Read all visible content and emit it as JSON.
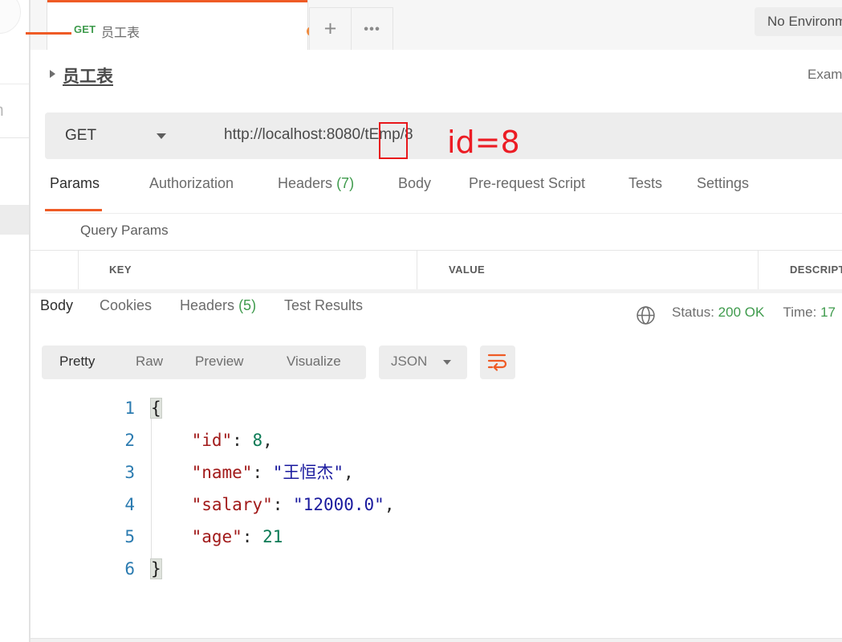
{
  "left_rail": {
    "glyph_fragment": "n"
  },
  "tabbar": {
    "request_tab": {
      "method": "GET",
      "title": "员工表",
      "unsaved": true
    },
    "new_tab_icon": "plus-icon",
    "more_icon": "ellipsis-icon",
    "environment": "No Environment"
  },
  "breadcrumb": {
    "name": "员工表",
    "examples_label": "Examples"
  },
  "url_bar": {
    "method": "GET",
    "url": "http://localhost:8080/tEmp/8"
  },
  "annotation": {
    "label": "id=8",
    "color": "#ec1c24"
  },
  "request_tabs": [
    {
      "label": "Params",
      "count": null,
      "active": true
    },
    {
      "label": "Authorization",
      "count": null,
      "active": false
    },
    {
      "label": "Headers",
      "count": "(7)",
      "active": false
    },
    {
      "label": "Body",
      "count": null,
      "active": false
    },
    {
      "label": "Pre-request Script",
      "count": null,
      "active": false
    },
    {
      "label": "Tests",
      "count": null,
      "active": false
    },
    {
      "label": "Settings",
      "count": null,
      "active": false
    }
  ],
  "query_params": {
    "section_label": "Query Params",
    "columns": [
      "KEY",
      "VALUE",
      "DESCRIPTION"
    ]
  },
  "response_tabs": [
    {
      "label": "Body",
      "count": null,
      "active": true
    },
    {
      "label": "Cookies",
      "count": null,
      "active": false
    },
    {
      "label": "Headers",
      "count": "(5)",
      "active": false
    },
    {
      "label": "Test Results",
      "count": null,
      "active": false
    }
  ],
  "response_meta": {
    "status_label": "Status:",
    "status_value": "200 OK",
    "time_label": "Time:",
    "time_value": "17",
    "globe_icon": "globe-icon"
  },
  "format_toolbar": {
    "buttons": [
      {
        "label": "Pretty",
        "active": true
      },
      {
        "label": "Raw",
        "active": false
      },
      {
        "label": "Preview",
        "active": false
      },
      {
        "label": "Visualize",
        "active": false
      }
    ],
    "language": "JSON",
    "wrap_icon": "word-wrap-icon"
  },
  "response_body": {
    "language": "json",
    "lines": [
      {
        "n": "1",
        "tokens": [
          {
            "t": "{",
            "c": "tok-brace"
          }
        ]
      },
      {
        "n": "2",
        "tokens": [
          {
            "t": "    ",
            "c": "tok-punct"
          },
          {
            "t": "\"id\"",
            "c": "tok-key"
          },
          {
            "t": ": ",
            "c": "tok-punct"
          },
          {
            "t": "8",
            "c": "tok-num"
          },
          {
            "t": ",",
            "c": "tok-punct"
          }
        ]
      },
      {
        "n": "3",
        "tokens": [
          {
            "t": "    ",
            "c": "tok-punct"
          },
          {
            "t": "\"name\"",
            "c": "tok-key"
          },
          {
            "t": ": ",
            "c": "tok-punct"
          },
          {
            "t": "\"王恒杰\"",
            "c": "tok-str"
          },
          {
            "t": ",",
            "c": "tok-punct"
          }
        ]
      },
      {
        "n": "4",
        "tokens": [
          {
            "t": "    ",
            "c": "tok-punct"
          },
          {
            "t": "\"salary\"",
            "c": "tok-key"
          },
          {
            "t": ": ",
            "c": "tok-punct"
          },
          {
            "t": "\"12000.0\"",
            "c": "tok-str"
          },
          {
            "t": ",",
            "c": "tok-punct"
          }
        ]
      },
      {
        "n": "5",
        "tokens": [
          {
            "t": "    ",
            "c": "tok-punct"
          },
          {
            "t": "\"age\"",
            "c": "tok-key"
          },
          {
            "t": ": ",
            "c": "tok-punct"
          },
          {
            "t": "21",
            "c": "tok-num"
          }
        ]
      },
      {
        "n": "6",
        "tokens": [
          {
            "t": "}",
            "c": "tok-brace"
          }
        ]
      }
    ],
    "parsed": {
      "id": 8,
      "name": "王恒杰",
      "salary": "12000.0",
      "age": 21
    }
  },
  "colors": {
    "accent": "#ef5b25",
    "method_get": "#3f9b4d",
    "status_ok": "#3f9b4d",
    "annotation": "#ec1c24",
    "json_key": "#a11a1a",
    "json_string": "#1a1a9e",
    "json_number": "#0b7a55",
    "line_number": "#2b7bb0"
  }
}
